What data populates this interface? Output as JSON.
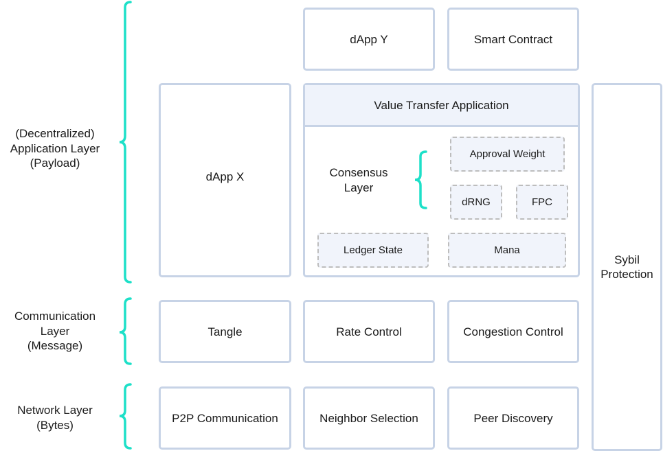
{
  "colors": {
    "bracket": "#1de0c8",
    "box_border": "#c7d3e6",
    "dashed_border": "#bdbdbd",
    "fill_light": "#eff3fb"
  },
  "layers": {
    "application": {
      "lines": [
        "(Decentralized)",
        "Application Layer",
        "(Payload)"
      ]
    },
    "communication": {
      "lines": [
        "Communication",
        "Layer",
        "(Message)"
      ]
    },
    "network": {
      "lines": [
        "Network Layer",
        "(Bytes)"
      ]
    }
  },
  "boxes": {
    "dapp_y": "dApp Y",
    "smart_contract": "Smart Contract",
    "dapp_x": "dApp X",
    "value_transfer": "Value Transfer Application",
    "tangle": "Tangle",
    "rate_control": "Rate Control",
    "congestion_control": "Congestion Control",
    "p2p": "P2P Communication",
    "neighbor_selection": "Neighbor Selection",
    "peer_discovery": "Peer Discovery",
    "sybil": [
      "Sybil",
      "Protection"
    ]
  },
  "consensus": {
    "label": [
      "Consensus",
      "Layer"
    ],
    "approval_weight": "Approval Weight",
    "drng": "dRNG",
    "fpc": "FPC",
    "ledger_state": "Ledger State",
    "mana": "Mana"
  }
}
